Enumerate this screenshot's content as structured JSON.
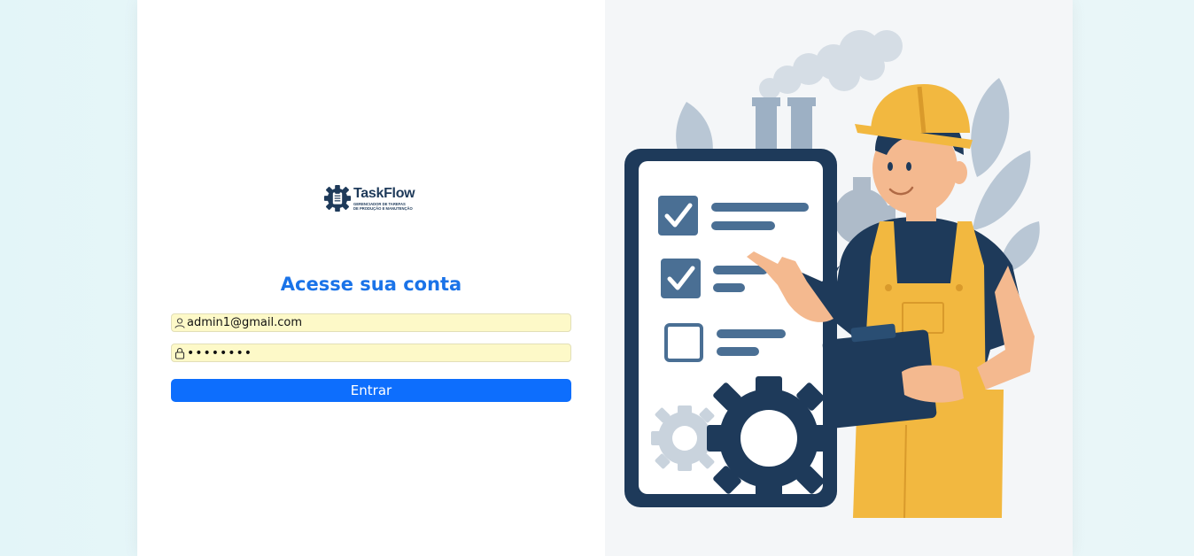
{
  "brand": {
    "name": "TaskFlow",
    "tagline_line1": "GERENCIADOR DE TAREFAS",
    "tagline_line2": "DE PRODUÇÃO E MANUTENÇÃO"
  },
  "login": {
    "heading": "Acesse sua conta",
    "email_value": "admin1@gmail.com",
    "password_value": "••••••••",
    "submit_label": "Entrar"
  },
  "icons": {
    "email_icon": "user-icon",
    "password_icon": "lock-icon",
    "logo_icon": "gear-clipboard-icon"
  },
  "colors": {
    "accent": "#0d6efd",
    "heading": "#1a73e8",
    "autofill": "#fdf9c8",
    "navy": "#1e3a5a",
    "helmet": "#f2b840"
  }
}
